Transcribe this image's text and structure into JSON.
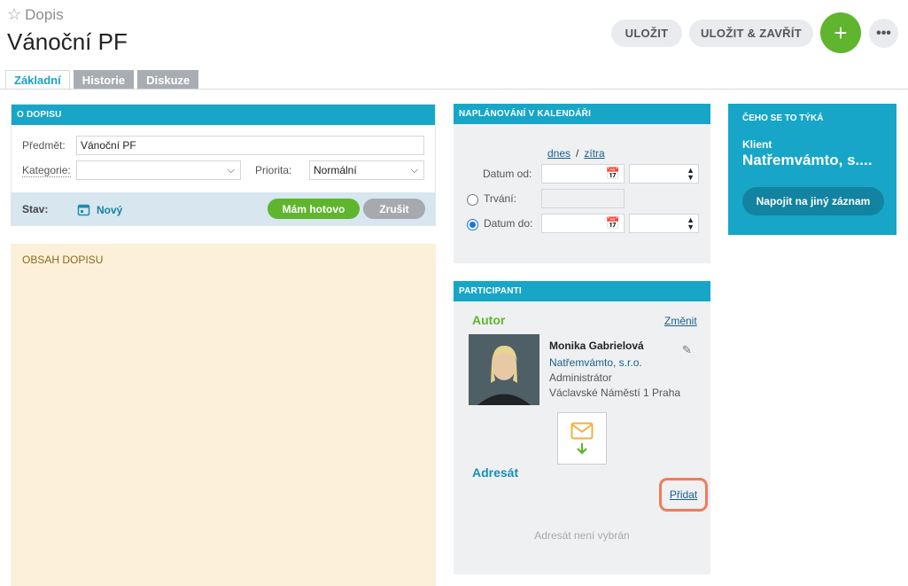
{
  "header": {
    "breadcrumb": "Dopis",
    "title": "Vánoční PF"
  },
  "toolbar": {
    "save_label": "ULOŽIT",
    "save_close_label": "ULOŽIT & ZAVŘÍT",
    "add_label": "+",
    "more_label": "•••"
  },
  "tabs": [
    {
      "label": "Základní",
      "active": true
    },
    {
      "label": "Historie"
    },
    {
      "label": "Diskuze"
    }
  ],
  "about": {
    "header": "O DOPISU",
    "subject_label": "Předmět:",
    "subject_value": "Vánoční PF",
    "category_label": "Kategorie:",
    "category_value": "",
    "priority_label": "Priorita:",
    "priority_value": "Normální",
    "status_label": "Stav:",
    "status_value": "Nový",
    "done_label": "Mám hotovo",
    "cancel_label": "Zrušit"
  },
  "content": {
    "header": "OBSAH DOPISU"
  },
  "calendar": {
    "header": "NAPLÁNOVÁNÍ V KALENDÁŘI",
    "today": "dnes",
    "sep": "/",
    "tomorrow": "zítra",
    "date_from_label": "Datum od:",
    "duration_label": "Trvání:",
    "date_to_label": "Datum do:"
  },
  "participants": {
    "header": "PARTICIPANTI",
    "author_label": "Autor",
    "change_label": "Změnit",
    "author": {
      "name": "Monika Gabrielová",
      "company": "Natřemvámto, s.r.o.",
      "role": "Administrátor",
      "address": "Václavské Náměstí 1 Praha"
    },
    "recipient_label": "Adresát",
    "add_label": "Přidat",
    "empty_recipient": "Adresát není vybrán"
  },
  "related": {
    "header": "ČEHO SE TO TÝKÁ",
    "client_label": "Klient",
    "client_name": "Natřemvámto, s....",
    "link_button": "Napojit na jiný záznam"
  },
  "colors": {
    "accent": "#17a6c7",
    "green": "#5fb52e",
    "note": "#fdf0d8",
    "highlight": "#f07b5a"
  }
}
